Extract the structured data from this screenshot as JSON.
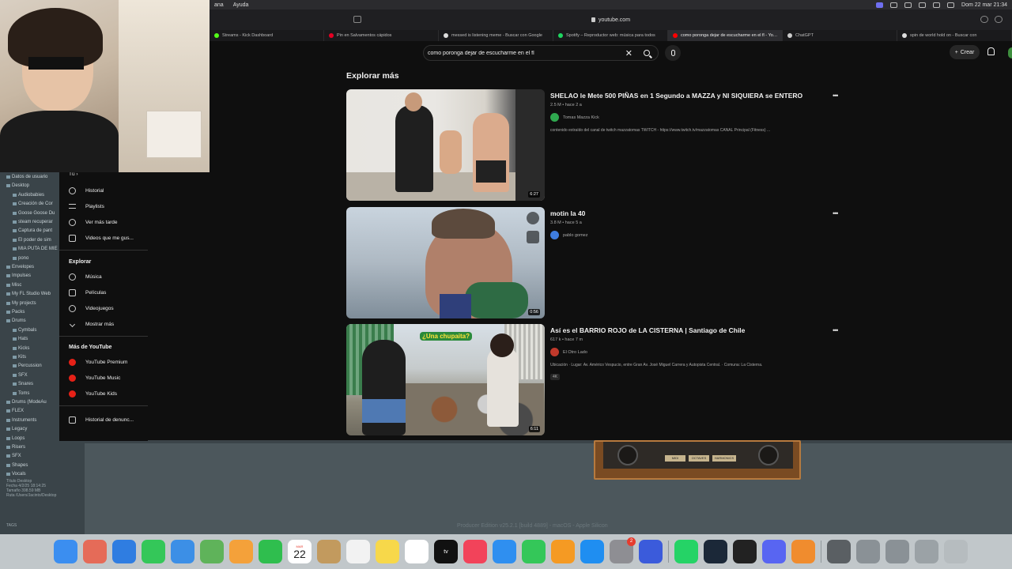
{
  "menubar": {
    "left_items": [
      "ana",
      "Ayuda"
    ],
    "datetime": "Dom 22 mar  21:34"
  },
  "browser": {
    "url": "youtube.com",
    "tabs": [
      {
        "label": "Streams - Kick Dashboard",
        "color": "#53fc18"
      },
      {
        "label": "Pin en Salvamentos cápidos",
        "color": "#e60023"
      },
      {
        "label": "messed is listening meme - Buscar con Google",
        "color": "#dddddd"
      },
      {
        "label": "Spotify – Reproductor web: música para todos",
        "color": "#1ed760"
      },
      {
        "label": "como poronga dejar de escucharme en el fl - Yo…",
        "color": "#ff0000",
        "active": true
      },
      {
        "label": "ChatGPT",
        "color": "#cccccc"
      },
      {
        "label": "spin de world hold on - Buscar con",
        "color": "#dddddd"
      }
    ]
  },
  "youtube": {
    "search_value": "como poronga dejar de escucharme en el fl",
    "create_label": "Crear",
    "nav": {
      "you_label": "Tú",
      "you_items": [
        "Historial",
        "Playlists",
        "Ver más tarde",
        "Videos que me gus..."
      ],
      "explore_heading": "Explorar",
      "explore_items": [
        "Música",
        "Películas",
        "Videojuegos",
        "Mostrar más"
      ],
      "more_heading": "Más de YouTube",
      "more_items": [
        "YouTube Premium",
        "YouTube Music",
        "YouTube Kids"
      ],
      "report_history": "Historial de denunc..."
    },
    "section_title": "Explorar más",
    "videos": [
      {
        "title": "SHELAO le Mete 500 PIÑAS en 1 Segundo a MAZZA y NI SIQUIERA se ENTERO",
        "meta": "2.5 M • hace 2 a",
        "channel": "Tomas Mazza Kick",
        "channel_color": "#2fa84f",
        "description": "contenido extraído del canal de twitch mazzatomas TWITCH - https://www.twitch.tv/mazzatomas CANAL Principal (Fitness) ...",
        "duration": "6:27",
        "badge": ""
      },
      {
        "title": "motin la 40",
        "meta": "3.8 M • hace 5 a",
        "channel": "pablo gomez",
        "channel_color": "#3e7de0",
        "description": "",
        "duration": "0:56",
        "badge": ""
      },
      {
        "title": "Así es el BARRIO ROJO de LA CISTERNA | Santiago de Chile",
        "meta": "617 k • hace 7 m",
        "channel": "El Otro Lado",
        "channel_color": "#c0392b",
        "description": "Ubicación  ·  Lugar: Av. Américo Vespucio, entre Gran Av. José Miguel Carrera y Autopista Central.  ·  Comuna: La Cisterna.",
        "duration": "6:11",
        "badge": "4K",
        "thumb_caption": "¿Una chupaita?"
      }
    ]
  },
  "fl_studio": {
    "browser_items": [
      "Datos de usuario",
      "Desktop",
      "Audiobabies",
      "Creación de Cor",
      "Goose Goose Du",
      "steam recuperar",
      "Captura de pant",
      "El poder de sim",
      "MIA PUTA DE MIE",
      "pono",
      "Envelopes",
      "Impulses",
      "Misc",
      "My FL Studio Web",
      "My projects",
      "Packs",
      "Drums",
      "Cymbals",
      "Hats",
      "Kicks",
      "Kits",
      "Percussion",
      "SFX",
      "Snares",
      "Toms",
      "Drums (ModeAu",
      "FLEX",
      "Instruments",
      "Legacy",
      "Loops",
      "Risers",
      "SFX",
      "Shapes",
      "Vocals"
    ],
    "info_lines": [
      "Título     Desktop",
      "Fecha      4/2/25 18:14:25",
      "Tamaño   398.59 MB",
      "Ruta        /Users/Jacinto/Desktop"
    ],
    "search_label": "TAGS",
    "status_text": "Producer Edition v25.2.1 [build 4889] - macOS - Apple Silicon",
    "plugin_buttons": [
      "MIDI",
      "OCTAVES",
      "HARMONICS"
    ]
  },
  "dock": {
    "calendar_month": "MAR",
    "calendar_day": "22",
    "settings_badge": "2",
    "tv_label": "tv"
  }
}
